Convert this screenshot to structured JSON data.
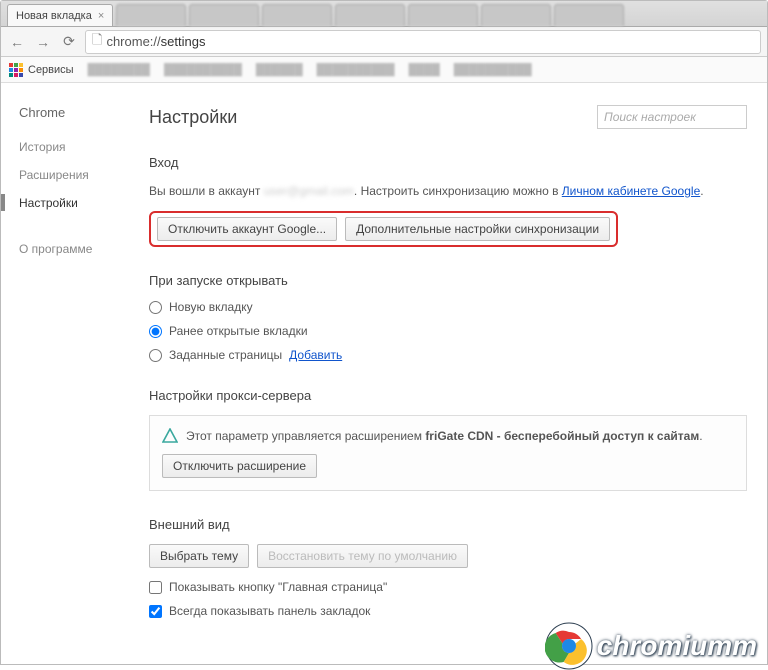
{
  "tabs": {
    "active": "Новая вкладка"
  },
  "url": {
    "prefix": "chrome://",
    "path": "settings"
  },
  "bookmarks": {
    "apps": "Сервисы"
  },
  "sidebar": {
    "title": "Chrome",
    "history": "История",
    "extensions": "Расширения",
    "settings": "Настройки",
    "about": "О программе"
  },
  "header": {
    "title": "Настройки",
    "search_placeholder": "Поиск настроек"
  },
  "signin": {
    "heading": "Вход",
    "text_1": "Вы вошли в аккаунт ",
    "email_blur": "user@gmail.com",
    "text_2": ". Настроить синхронизацию можно в ",
    "link": "Личном кабинете Google",
    "btn_disconnect": "Отключить аккаунт Google...",
    "btn_sync": "Дополнительные настройки синхронизации"
  },
  "startup": {
    "heading": "При запуске открывать",
    "opt_newtab": "Новую вкладку",
    "opt_continue": "Ранее открытые вкладки",
    "opt_specific": "Заданные страницы ",
    "opt_specific_link": "Добавить"
  },
  "proxy": {
    "heading": "Настройки прокси-сервера",
    "line_1": "Этот параметр управляется расширением ",
    "ext": "friGate CDN - бесперебойный доступ к сайтам",
    "btn_disable": "Отключить расширение"
  },
  "appearance": {
    "heading": "Внешний вид",
    "btn_theme": "Выбрать тему",
    "btn_reset": "Восстановить тему по умолчанию",
    "chk_home": "Показывать кнопку \"Главная страница\"",
    "chk_bookmarks": "Всегда показывать панель закладок"
  },
  "watermark": "chromiumm"
}
